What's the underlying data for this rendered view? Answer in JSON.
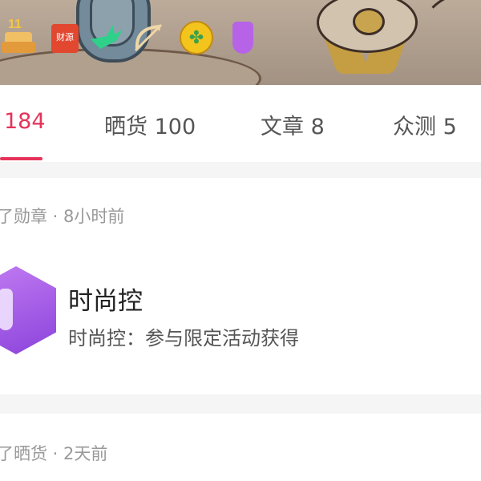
{
  "header": {
    "badges": [
      {
        "icon": "birthday-cake-icon",
        "text": "11"
      },
      {
        "icon": "gift-box-icon",
        "text": "财源"
      },
      {
        "icon": "bird-icon"
      },
      {
        "icon": "cupid-bow-icon"
      },
      {
        "icon": "clover-coin-icon"
      },
      {
        "icon": "dress-icon"
      }
    ]
  },
  "tabs": [
    {
      "label": "184",
      "active": true
    },
    {
      "label": "晒货 100",
      "active": false
    },
    {
      "label": "文章 8",
      "active": false
    },
    {
      "label": "众测 5",
      "active": false
    }
  ],
  "feed": [
    {
      "meta": "了勋章 · 8小时前",
      "badge_title": "时尚控",
      "badge_description": "时尚控：参与限定活动获得"
    },
    {
      "meta": "了晒货 · 2天前"
    }
  ],
  "colors": {
    "accent": "#e5335a",
    "separator": "#f5f5f5",
    "meta_text": "#999999"
  }
}
